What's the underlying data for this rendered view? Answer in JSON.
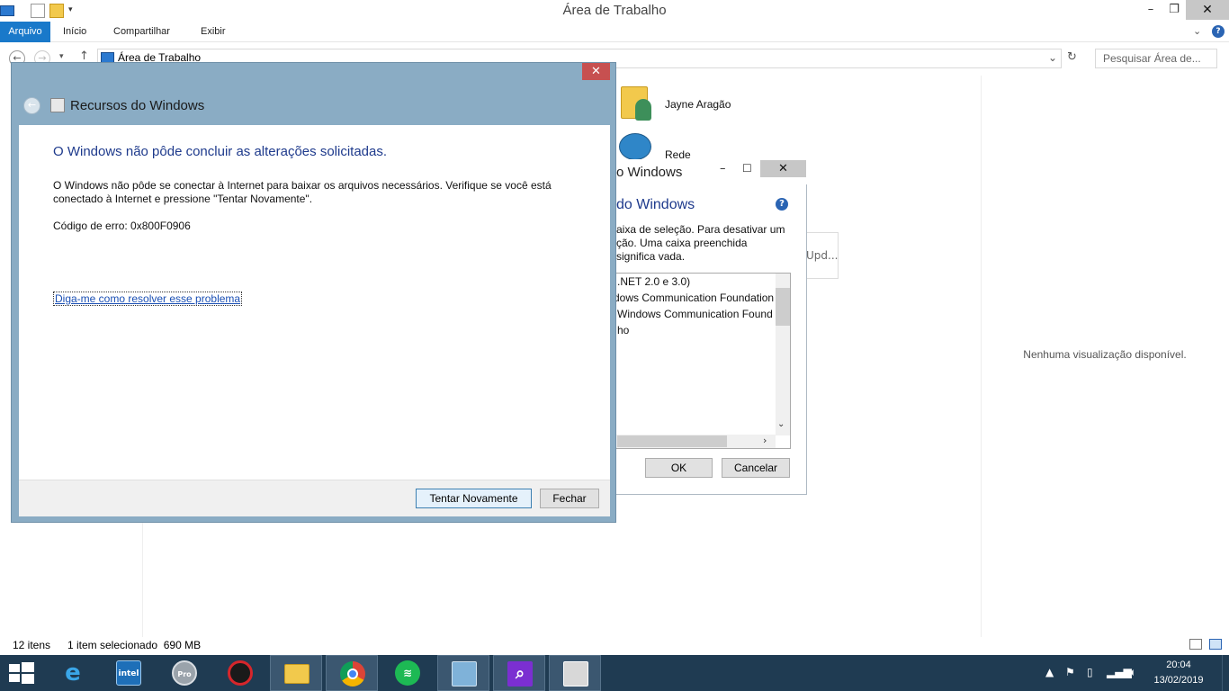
{
  "explorer": {
    "title": "Área de Trabalho",
    "ribbon_tabs": [
      "Arquivo",
      "Início",
      "Compartilhar",
      "Exibir"
    ],
    "address": "Área de Trabalho",
    "search_placeholder": "Pesquisar Área de...",
    "items": [
      {
        "label": "Jayne Aragão",
        "icon": "user-folder-icon"
      },
      {
        "label": "Rede",
        "icon": "network-globe-icon"
      }
    ],
    "partial_item": "Upd...",
    "preview": "Nenhuma visualização disponível.",
    "status": {
      "count": "12 itens",
      "selection": "1 item selecionado  690 MB"
    }
  },
  "features_dialog": {
    "title": "o Windows",
    "heading": "do Windows",
    "description": "aixa de seleção. Para desativar um ção. Uma caixa preenchida significa vada.",
    "tree": [
      ".NET 2.0 e 3.0)",
      "dows Communication Foundation",
      "Windows Communication Found",
      "ho"
    ],
    "ok": "OK",
    "cancel": "Cancelar"
  },
  "error_dialog": {
    "title": "Recursos do Windows",
    "heading": "O Windows não pôde concluir as alterações solicitadas.",
    "message": "O Windows não pôde se conectar à Internet para baixar os arquivos necessários. Verifique se você está conectado à Internet e pressione \"Tentar Novamente\".",
    "error_code": "Código de erro: 0x800F0906",
    "help_link": "Diga-me como resolver esse problema",
    "retry": "Tentar Novamente",
    "close": "Fechar"
  },
  "taskbar": {
    "apps": [
      "internet-explorer-icon",
      "intel-graphics-icon",
      "google-earth-pro-icon",
      "red-gear-app-icon",
      "file-explorer-icon",
      "chrome-icon",
      "spotify-icon",
      "remote-desktop-icon",
      "search-magnifier-icon",
      "windows-features-icon"
    ],
    "time": "20:04",
    "date": "13/02/2019"
  },
  "colors": {
    "accent": "#1979ca",
    "dialog_frame": "#8aacc4",
    "close_red": "#c75050",
    "taskbar": "#1f3b52",
    "heading_blue": "#1e3a8c"
  }
}
